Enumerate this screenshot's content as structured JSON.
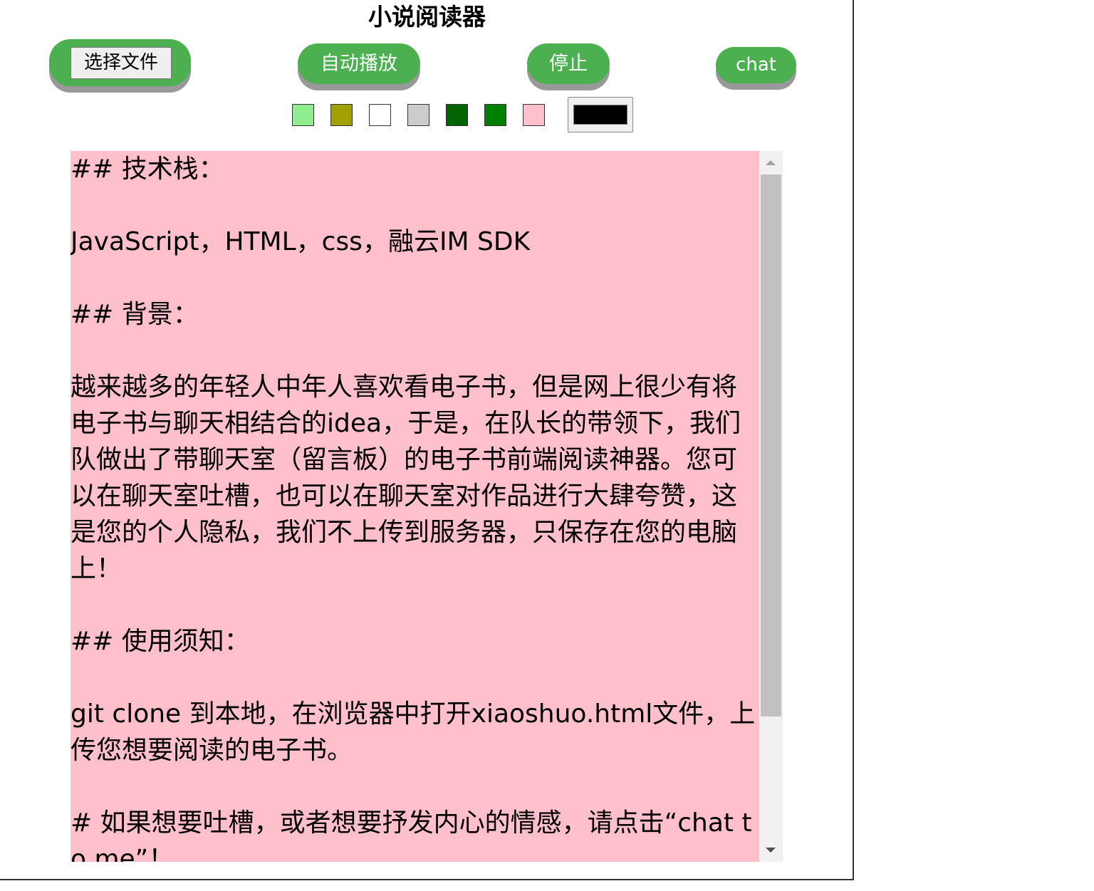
{
  "page": {
    "title": "小说阅读器"
  },
  "toolbar": {
    "file_button_label": "选择文件",
    "autoplay_label": "自动播放",
    "stop_label": "停止",
    "chat_label": "chat"
  },
  "background_swatches": [
    "#90ee90",
    "#a0a000",
    "#ffffff",
    "#cccccc",
    "#006400",
    "#008000",
    "#ffc0cb"
  ],
  "text_color_picker": {
    "value": "#000000"
  },
  "reader": {
    "background": "#ffc0cb",
    "text": "## 技术栈：\n\nJavaScript，HTML，css，融云IM SDK\n\n## 背景：\n\n越来越多的年轻人中年人喜欢看电子书，但是网上很少有将电子书与聊天相结合的idea，于是，在队长的带领下，我们队做出了带聊天室（留言板）的电子书前端阅读神器。您可以在聊天室吐槽，也可以在聊天室对作品进行大肆夸赞，这是您的个人隐私，我们不上传到服务器，只保存在您的电脑上！\n\n## 使用须知：\n\ngit clone 到本地，在浏览器中打开xiaoshuo.html文件，上传您想要阅读的电子书。\n\n# 如果想要吐槽，或者想要抒发内心的情感，请点击“chat to me”！"
  }
}
